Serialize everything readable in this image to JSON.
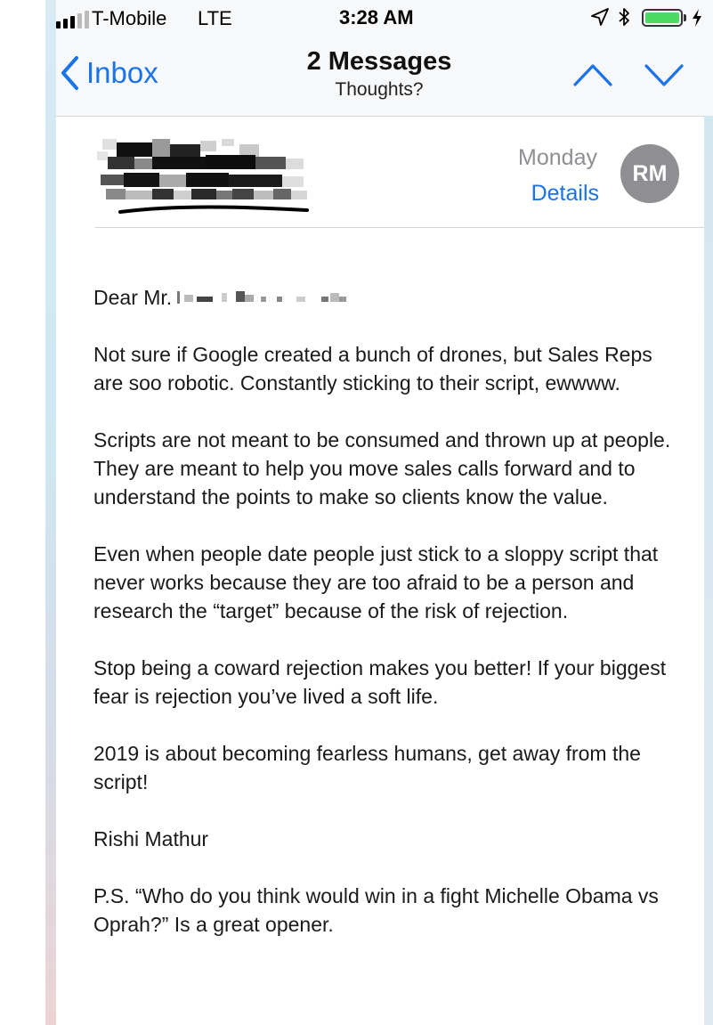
{
  "status_bar": {
    "carrier": "T-Mobile",
    "network": "LTE",
    "time": "3:28 AM",
    "signal_bars": 3,
    "signal_total": 5,
    "battery_level": 1.0,
    "icons": [
      "location-arrow-icon",
      "bluetooth-icon",
      "battery-icon",
      "charging-icon"
    ]
  },
  "nav": {
    "back_label": "Inbox",
    "title": "2 Messages",
    "subtitle": "Thoughts?"
  },
  "message": {
    "date": "Monday",
    "details_label": "Details",
    "avatar_initials": "RM",
    "greeting": "Dear Mr.",
    "paragraphs": [
      "Not sure if Google created a bunch of drones, but Sales Reps are soo robotic. Constantly sticking to their script, ewwww.",
      "Scripts are not meant to be consumed and thrown up at people. They are meant to help you move sales calls forward and to understand the points to make so clients know the value.",
      "Even when people date people just stick to a sloppy script that never works because they are too afraid to be a person and research the “target” because of the risk of rejection.",
      "Stop being a coward rejection makes you better! If your biggest fear is rejection you’ve lived a soft life.",
      "2019 is about becoming fearless humans, get away from the script!",
      "Rishi Mathur",
      "P.S. “Who do you think would win in a fight Michelle Obama vs Oprah?” Is a great opener."
    ]
  },
  "colors": {
    "accent": "#1a73e8",
    "avatar_bg": "#8e8e93",
    "battery_fill": "#4cd964",
    "bar_bg": "#f7f8f9"
  }
}
